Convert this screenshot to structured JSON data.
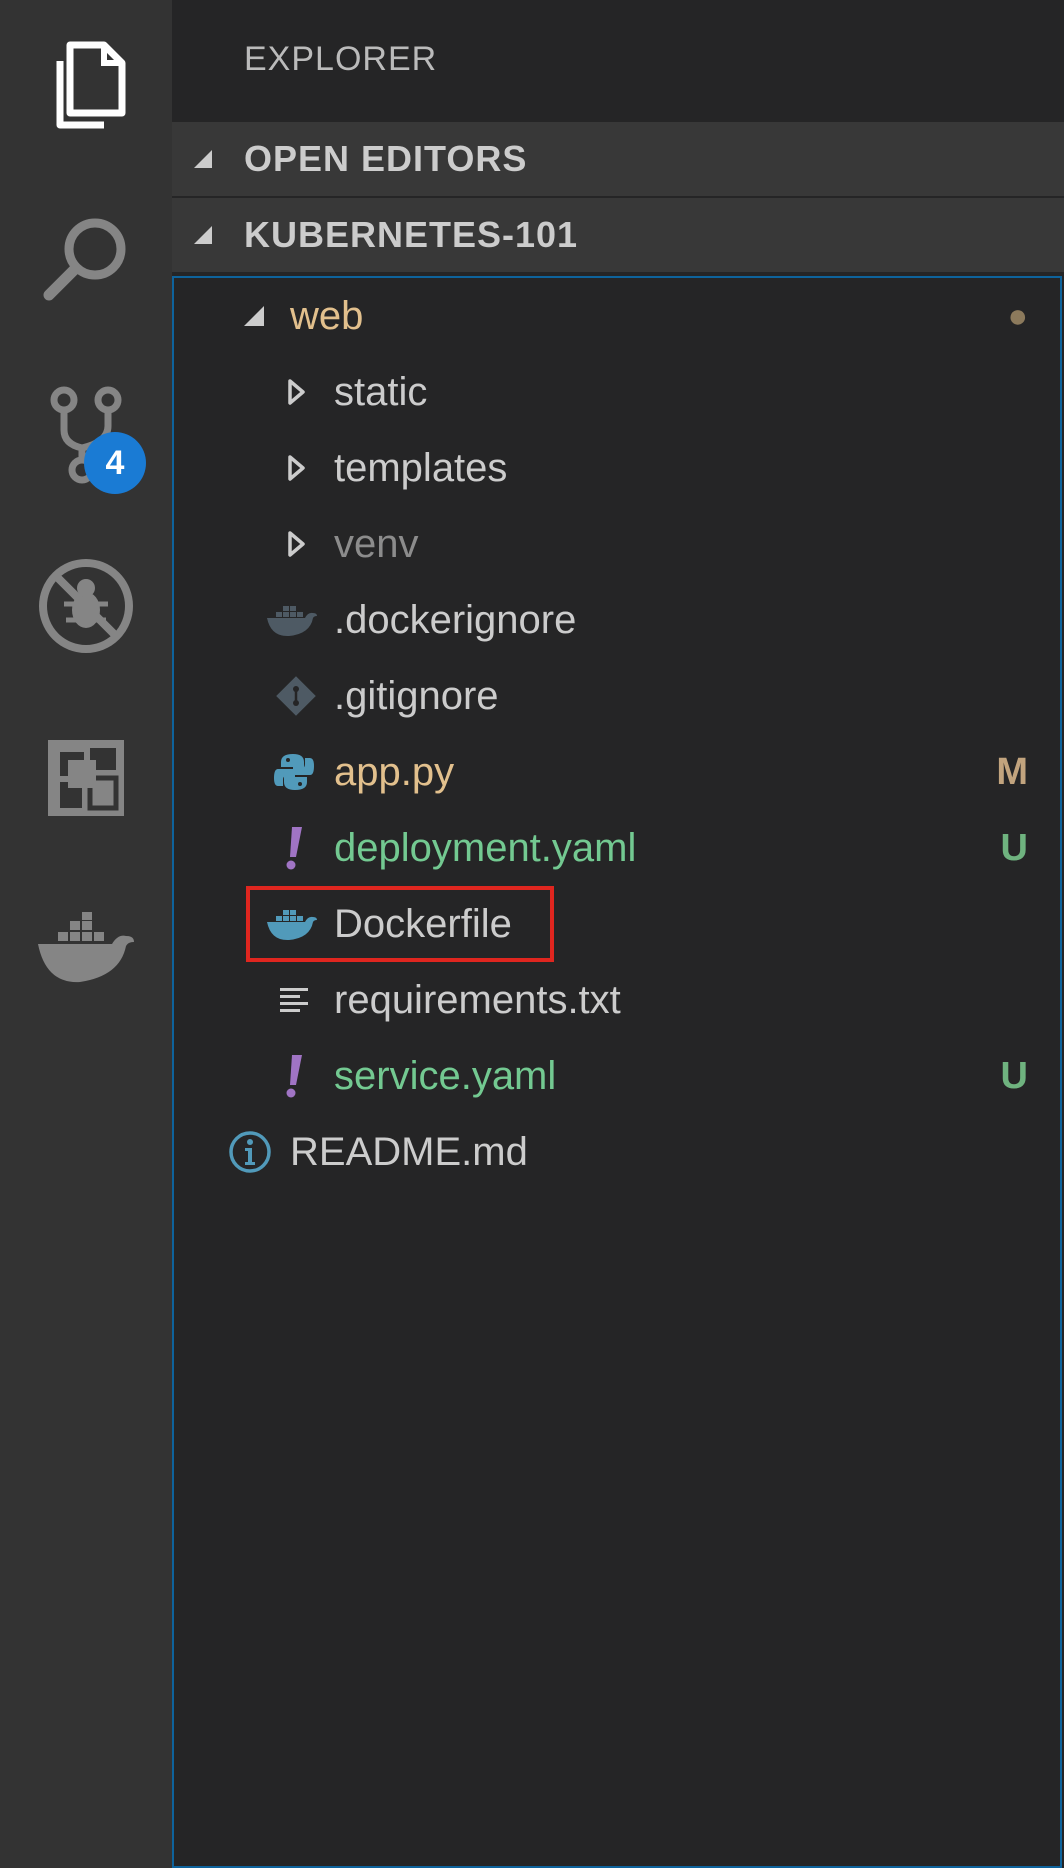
{
  "activity_bar": {
    "items": [
      {
        "name": "explorer",
        "icon": "files-icon"
      },
      {
        "name": "search",
        "icon": "search-icon"
      },
      {
        "name": "source-control",
        "icon": "source-control-icon"
      },
      {
        "name": "debug",
        "icon": "no-debug-icon"
      },
      {
        "name": "extensions",
        "icon": "extensions-icon"
      },
      {
        "name": "docker",
        "icon": "docker-whale-icon"
      }
    ],
    "source_control_badge": "4"
  },
  "sidebar": {
    "title": "EXPLORER",
    "sections": [
      {
        "label": "OPEN EDITORS",
        "expanded": true
      },
      {
        "label": "KUBERNETES-101",
        "expanded": true
      }
    ]
  },
  "tree": {
    "items": [
      {
        "label": "web",
        "kind": "folder",
        "expanded": true,
        "icon": "twist-down-icon",
        "color": "#e2c08d",
        "decoration": "●",
        "decoration_color": "#8c7a5c"
      },
      {
        "label": "static",
        "kind": "folder",
        "expanded": false,
        "icon": "twist-right-icon",
        "color": "#cccccc"
      },
      {
        "label": "templates",
        "kind": "folder",
        "expanded": false,
        "icon": "twist-right-icon",
        "color": "#cccccc"
      },
      {
        "label": "venv",
        "kind": "folder",
        "expanded": false,
        "icon": "twist-right-icon",
        "color": "#8c8c8c"
      },
      {
        "label": ".dockerignore",
        "kind": "file",
        "icon": "docker-file-icon",
        "color": "#cccccc"
      },
      {
        "label": ".gitignore",
        "kind": "file",
        "icon": "git-file-icon",
        "color": "#cccccc"
      },
      {
        "label": "app.py",
        "kind": "file",
        "icon": "python-file-icon",
        "color": "#e2c08d",
        "decoration": "M",
        "decoration_color": "#c2a47e"
      },
      {
        "label": "deployment.yaml",
        "kind": "file",
        "icon": "yaml-file-icon",
        "color": "#73c991",
        "decoration": "U",
        "decoration_color": "#6fb37f"
      },
      {
        "label": "Dockerfile",
        "kind": "file",
        "icon": "docker-file-icon",
        "color": "#cccccc",
        "highlighted": true
      },
      {
        "label": "requirements.txt",
        "kind": "file",
        "icon": "text-file-icon",
        "color": "#cccccc"
      },
      {
        "label": "service.yaml",
        "kind": "file",
        "icon": "yaml-file-icon",
        "color": "#73c991",
        "decoration": "U",
        "decoration_color": "#6fb37f"
      },
      {
        "label": "README.md",
        "kind": "file",
        "icon": "info-file-icon",
        "color": "#cccccc"
      }
    ]
  },
  "colors": {
    "activity_bar_bg": "#333333",
    "sidebar_bg": "#252526",
    "section_header_bg": "#383838",
    "badge_bg": "#1a7bd4",
    "focus_border": "#0e639c",
    "highlight_border": "#e0261f"
  }
}
